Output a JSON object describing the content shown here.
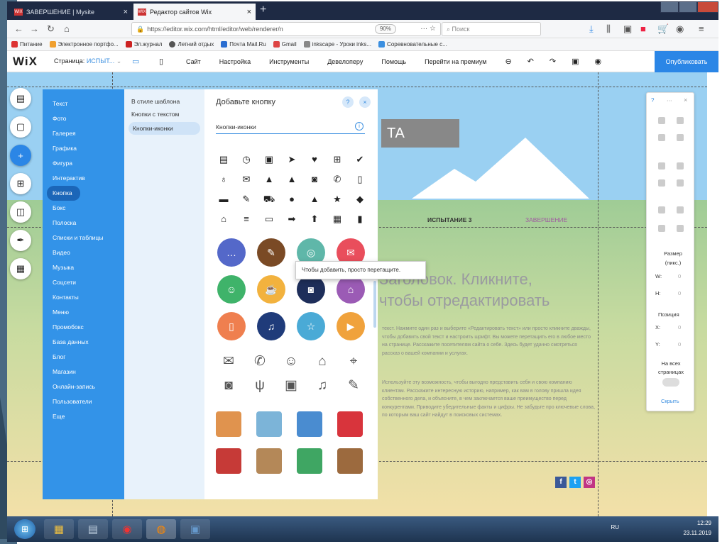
{
  "browser": {
    "tabs": [
      {
        "label": "ЗАВЕРШЕНИЕ | Mysite",
        "favicon": "wix"
      },
      {
        "label": "Редактор сайтов Wix",
        "favicon": "wix"
      }
    ],
    "new_tab": "+",
    "url": "https://editor.wix.com/html/editor/web/renderer/n",
    "zoom": "90%",
    "search_placeholder": "Поиск",
    "bookmarks": [
      "Питание",
      "Электронное портфо...",
      "Эл.журнал",
      "Летний отдых",
      "Почта Mail.Ru",
      "Gmail",
      "inkscape - Уроки inks...",
      "Соревновательные с..."
    ]
  },
  "wix_topbar": {
    "logo": "WiX",
    "page_label": "Страница:",
    "page_value": "ИСПЫТ...",
    "menu": [
      "Сайт",
      "Настройка",
      "Инструменты",
      "Девелоперу",
      "Помощь",
      "Перейти на премиум"
    ],
    "publish": "Опубликовать"
  },
  "add_panel": {
    "categories": [
      "Текст",
      "Фото",
      "Галерея",
      "Графика",
      "Фигура",
      "Интерактив",
      "Кнопка",
      "Бокс",
      "Полоска",
      "Списки и таблицы",
      "Видео",
      "Музыка",
      "Соцсети",
      "Контакты",
      "Меню",
      "Промобокс",
      "База данных",
      "Блог",
      "Магазин",
      "Онлайн-запись",
      "Пользователи",
      "Еще"
    ],
    "selected_category": "Кнопка",
    "subcategories": [
      "В стиле шаблона",
      "Кнопки с текстом",
      "Кнопки-иконки"
    ],
    "selected_subcategory": "Кнопки-иконки",
    "title": "Добавьте кнопку",
    "help": "?",
    "close": "×",
    "section_label": "Кнопки-иконки",
    "section_info": "i",
    "glyph_icons": [
      "▤",
      "◷",
      "▣",
      "➤",
      "♥",
      "⊞",
      "✔",
      "♁",
      "✉",
      "▲",
      "▲",
      "◙",
      "✆",
      "▯",
      "▬",
      "✎",
      "⛟",
      "●",
      "▲",
      "★",
      "◆",
      "⌂",
      "≡",
      "▭",
      "➡",
      "⬆",
      "▦",
      "▮"
    ],
    "circle_buttons": [
      {
        "glyph": "…",
        "color": "#5468c9"
      },
      {
        "glyph": "✎",
        "color": "#7a4a25"
      },
      {
        "glyph": "◎",
        "color": "#5fb7a9"
      },
      {
        "glyph": "✉",
        "color": "#e94e5c"
      },
      {
        "glyph": "☺",
        "color": "#3fb36a"
      },
      {
        "glyph": "☕",
        "color": "#f2b23e"
      },
      {
        "glyph": "◙",
        "color": "#1e2e5a"
      },
      {
        "glyph": "⌂",
        "color": "#9b5bb5"
      },
      {
        "glyph": "▯",
        "color": "#ef7f4f"
      },
      {
        "glyph": "♫",
        "color": "#1f3b7a"
      },
      {
        "glyph": "☆",
        "color": "#4aaad6"
      },
      {
        "glyph": "▶",
        "color": "#f0a23c"
      }
    ],
    "outline_icons": [
      "✉",
      "✆",
      "☺",
      "⌂",
      "⌖",
      "◙",
      "ψ",
      "▣",
      "♫",
      "✎"
    ],
    "color_icons": [
      {
        "color": "#e0934e"
      },
      {
        "color": "#7cb4d8"
      },
      {
        "color": "#4a8cd0"
      },
      {
        "color": "#d8343c"
      },
      {
        "color": "#c63a37"
      },
      {
        "color": "#b48858"
      },
      {
        "color": "#3fa663"
      },
      {
        "color": "#9c6a3e"
      }
    ]
  },
  "tooltip": "Чтобы добавить, просто перетащите.",
  "site": {
    "title_partial": "ТА",
    "menu_item": "ИСПЫТАНИЕ 3",
    "menu_item_end": "ЗАВЕРШЕНИЕ",
    "heading_line1": "Заголовок. Кликните,",
    "heading_line2": "чтобы отредактировать",
    "para1": "текст. Нажмите один раз и выберите «Редактировать текст» или просто кликните дважды, чтобы добавить свой текст и настроить шрифт. Вы можете перетащить его в любое место на странице. Расскажите посетителям сайта о себе. Здесь будет удачно смотреться рассказ о вашей компании и услугах.",
    "para2": "Используйте эту возможность, чтобы выгодно представить себя и свою компанию клиентам. Расскажите интересную историю, например, как вам в голову пришла идея собственного дела, и объясните, в чем заключается ваше преимущество перед конкурентами. Приводите убедительные факты и цифры. Не забудьте про ключевые слова, по которым ваш сайт найдут в поисковых системах."
  },
  "inspector": {
    "size_label": "Размер (пикс.)",
    "w_label": "W:",
    "h_label": "H:",
    "pos_label": "Позиция",
    "x_label": "X:",
    "y_label": "Y:",
    "all_pages": "На всех страницах",
    "hide": "Скрыть",
    "value": "0"
  },
  "taskbar": {
    "lang": "RU",
    "time": "12:29",
    "date": "23.11.2019"
  }
}
